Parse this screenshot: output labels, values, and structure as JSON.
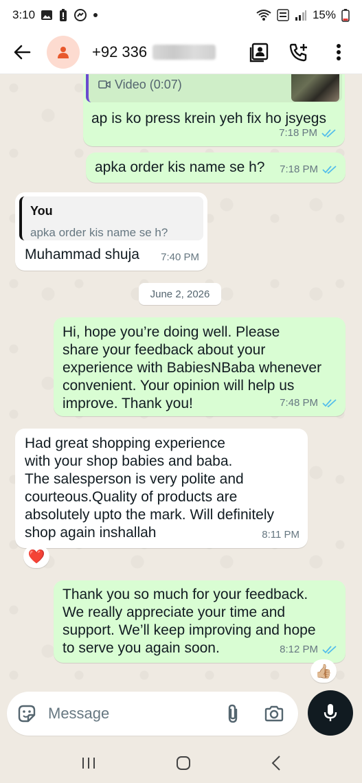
{
  "status_bar": {
    "time": "3:10",
    "battery": "15%"
  },
  "header": {
    "contact_prefix": "+92 336"
  },
  "messages": [
    {
      "kind": "partial_out",
      "label": "Video (0:07)",
      "text": "ap is ko press krein yeh fix ho jsyegs",
      "time": "7:18 PM"
    },
    {
      "kind": "out",
      "text": "apka order kis name se h?",
      "time": "7:18 PM"
    },
    {
      "kind": "in_reply",
      "quote_author": "You",
      "quote_text": "apka order kis name se h?",
      "text": "Muhammad shuja",
      "time": "7:40 PM"
    },
    {
      "kind": "out",
      "lines": [
        "Hi, hope you’re doing well. Please",
        "share your feedback about your",
        "experience with BabiesNBaba whenever",
        "convenient. Your opinion will help us",
        "improve. Thank you!"
      ],
      "time": "7:48 PM"
    },
    {
      "kind": "in",
      "lines": [
        "Had great  shopping experience",
        "with your shop babies and baba.",
        "The salesperson is very polite and",
        "courteous.Quality of products are",
        "absolutely upto the mark. Will definitely",
        "shop again inshallah"
      ],
      "time": "8:11 PM",
      "reaction": "❤️"
    },
    {
      "kind": "out",
      "lines": [
        "Thank you so much for your feedback.",
        "We really appreciate your time and",
        "support. We’ll keep improving and hope",
        "to serve you again soon."
      ],
      "time": "8:12 PM",
      "reaction": "👍🏼"
    }
  ],
  "date_separator": "June 2, 2026",
  "composer": {
    "placeholder": "Message"
  },
  "colors": {
    "outgoing_bubble": "#d9fdd3",
    "incoming_bubble": "#ffffff",
    "chat_background": "#efeae2",
    "read_ticks": "#53bdeb",
    "mic_button": "#111b21"
  }
}
